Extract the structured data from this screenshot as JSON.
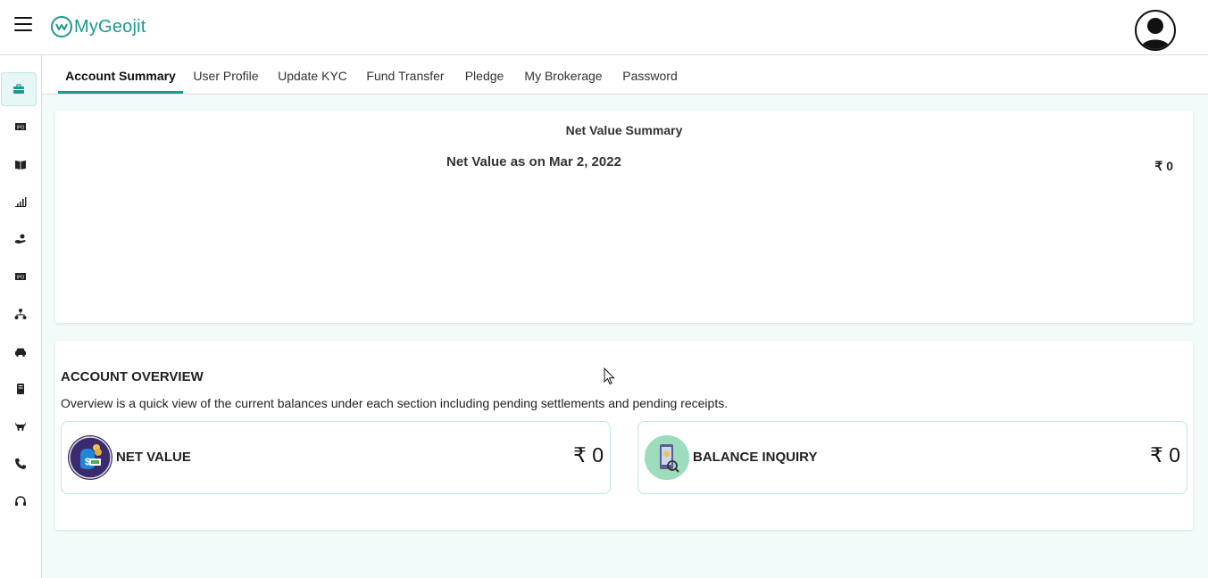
{
  "header": {
    "brand": "MyGeojit",
    "brand_color": "#1a9a8c"
  },
  "sidebar": {
    "items": [
      {
        "icon": "briefcase-icon"
      },
      {
        "icon": "ipo-icon"
      },
      {
        "icon": "book-icon"
      },
      {
        "icon": "bar-chart-icon"
      },
      {
        "icon": "hand-coin-icon"
      },
      {
        "icon": "ipo-icon"
      },
      {
        "icon": "network-icon"
      },
      {
        "icon": "car-icon"
      },
      {
        "icon": "document-icon"
      },
      {
        "icon": "bull-icon"
      },
      {
        "icon": "phone-icon"
      },
      {
        "icon": "headset-icon"
      }
    ]
  },
  "tabs": [
    {
      "label": "Account Summary"
    },
    {
      "label": "User Profile"
    },
    {
      "label": "Update KYC"
    },
    {
      "label": "Fund Transfer"
    },
    {
      "label": "Pledge"
    },
    {
      "label": "My Brokerage"
    },
    {
      "label": "Password"
    }
  ],
  "net_value_summary": {
    "title": "Net Value Summary",
    "date_label": "Net Value as on Mar 2, 2022",
    "amount": "₹ 0"
  },
  "account_overview": {
    "title": "ACCOUNT OVERVIEW",
    "description": "Overview is a quick view of the current balances under each section including pending settlements and pending receipts.",
    "cards": [
      {
        "label": "NET VALUE",
        "value": "₹ 0",
        "icon": "money-bag-icon"
      },
      {
        "label": "BALANCE INQUIRY",
        "value": "₹ 0",
        "icon": "phone-search-icon"
      }
    ]
  }
}
